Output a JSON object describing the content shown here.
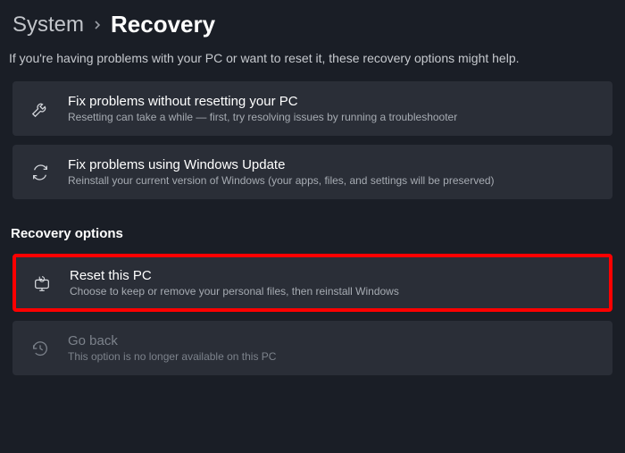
{
  "breadcrumb": {
    "parent": "System",
    "current": "Recovery"
  },
  "intro": "If you're having problems with your PC or want to reset it, these recovery options might help.",
  "cards": {
    "fix_problems": {
      "title": "Fix problems without resetting your PC",
      "desc": "Resetting can take a while — first, try resolving issues by running a troubleshooter"
    },
    "windows_update": {
      "title": "Fix problems using Windows Update",
      "desc": "Reinstall your current version of Windows (your apps, files, and settings will be preserved)"
    },
    "reset_pc": {
      "title": "Reset this PC",
      "desc": "Choose to keep or remove your personal files, then reinstall Windows"
    },
    "go_back": {
      "title": "Go back",
      "desc": "This option is no longer available on this PC"
    }
  },
  "section_title": "Recovery options"
}
